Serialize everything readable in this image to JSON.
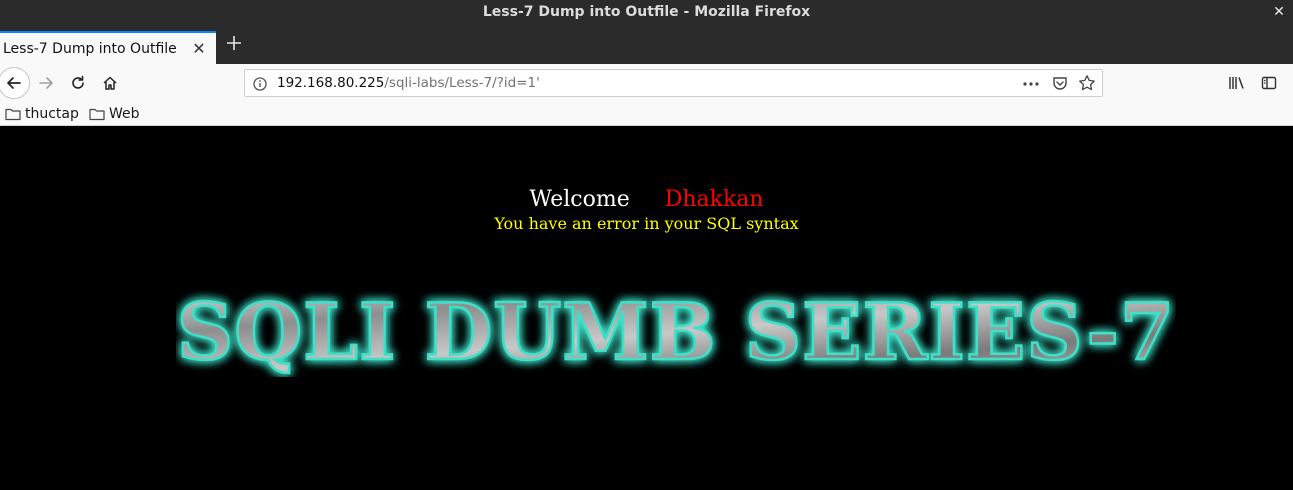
{
  "window": {
    "title": "Less-7 Dump into Outfile - Mozilla Firefox"
  },
  "tabs": [
    {
      "label": "Less-7 Dump into Outfile",
      "active": true
    }
  ],
  "urlbar": {
    "host": "192.168.80.225",
    "path": "/sqli-labs/Less-7/?id=1'"
  },
  "bookmarks": [
    {
      "label": "thuctap"
    },
    {
      "label": "Web"
    }
  ],
  "page": {
    "welcome": "Welcome",
    "name": "Dhakkan",
    "error": "You have an error in your SQL syntax",
    "banner": "SQLI DUMB SERIES-7"
  },
  "colors": {
    "welcome": "#ffffff",
    "name": "#ff0000",
    "error": "#ffff00",
    "banner_glow": "#3fe0c8",
    "accent": "#0a84ff"
  }
}
